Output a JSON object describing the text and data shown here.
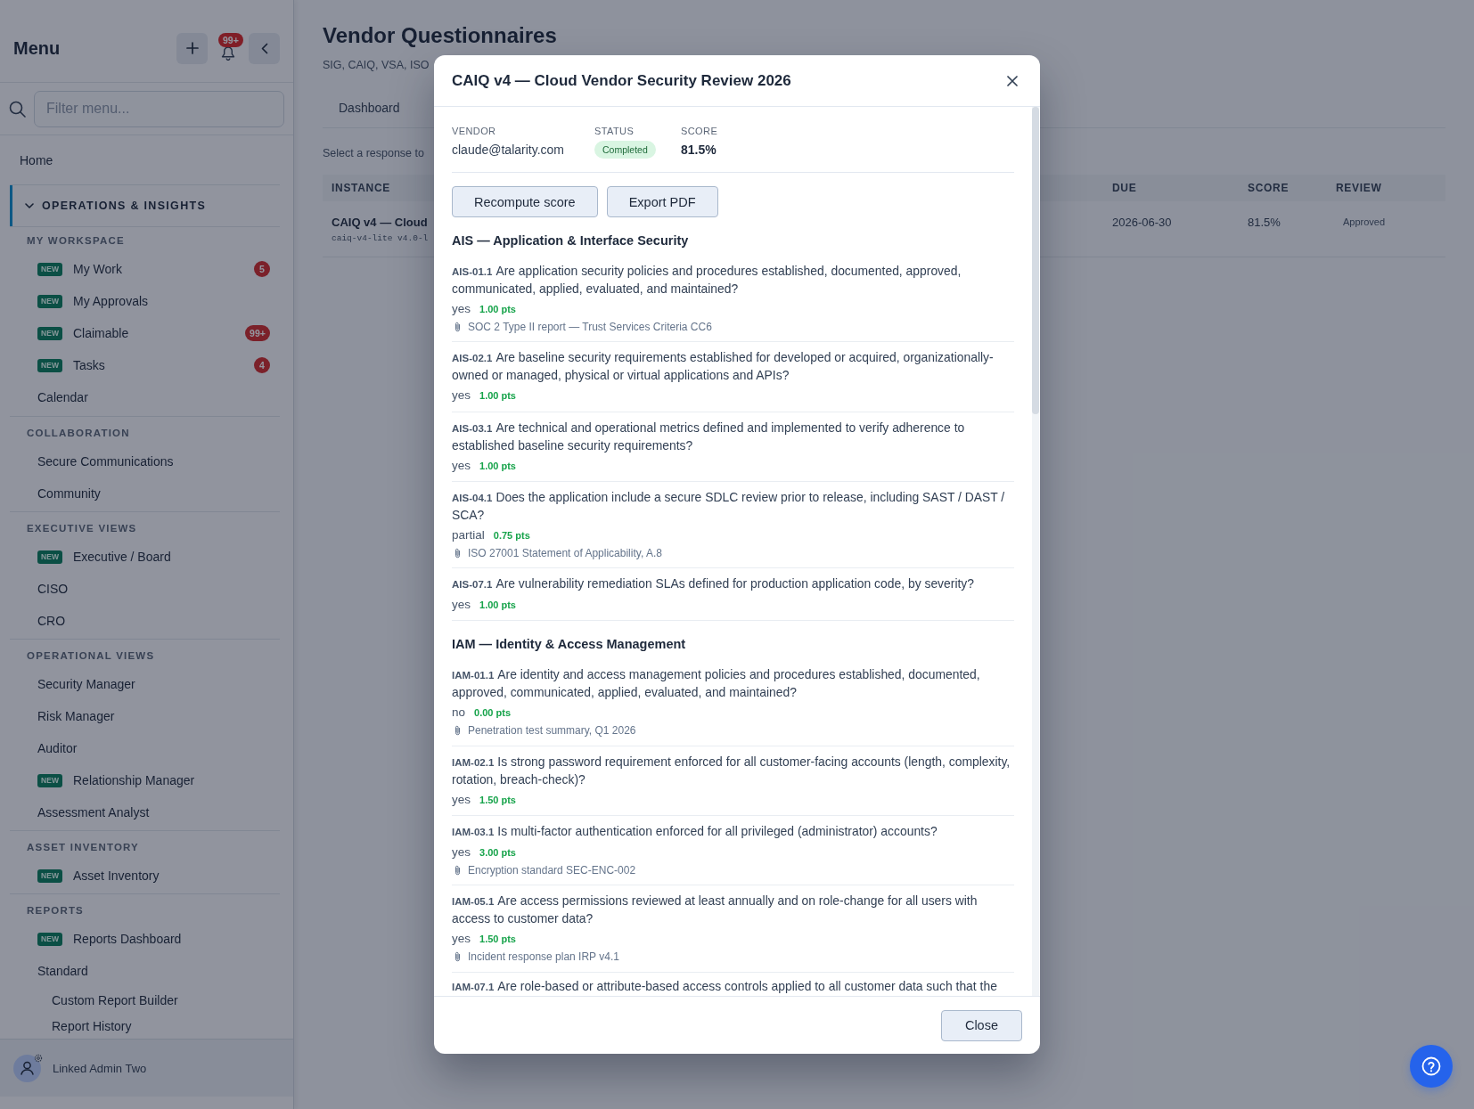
{
  "sidebar": {
    "title": "Menu",
    "notifications": "99+",
    "filter": {
      "placeholder": "Filter menu..."
    },
    "home": "Home",
    "section": {
      "label": "OPERATIONS & INSIGHTS",
      "expanded": true
    },
    "groups": [
      {
        "heading": "MY WORKSPACE",
        "items": [
          {
            "label": "My Work",
            "tag": "NEW",
            "count": "5"
          },
          {
            "label": "My Approvals",
            "tag": "NEW"
          },
          {
            "label": "Claimable",
            "tag": "NEW",
            "count": "99+"
          },
          {
            "label": "Tasks",
            "tag": "NEW",
            "count": "4"
          },
          {
            "label": "Calendar"
          }
        ]
      },
      {
        "heading": "COLLABORATION",
        "items": [
          {
            "label": "Secure Communications"
          },
          {
            "label": "Community"
          }
        ]
      },
      {
        "heading": "EXECUTIVE VIEWS",
        "items": [
          {
            "label": "Executive / Board",
            "tag": "NEW"
          },
          {
            "label": "CISO"
          },
          {
            "label": "CRO"
          }
        ]
      },
      {
        "heading": "OPERATIONAL VIEWS",
        "items": [
          {
            "label": "Security Manager"
          },
          {
            "label": "Risk Manager"
          },
          {
            "label": "Auditor"
          },
          {
            "label": "Relationship Manager",
            "tag": "NEW"
          },
          {
            "label": "Assessment Analyst"
          }
        ]
      },
      {
        "heading": "ASSET INVENTORY",
        "items": [
          {
            "label": "Asset Inventory",
            "tag": "NEW"
          }
        ]
      },
      {
        "heading": "REPORTS",
        "items": [
          {
            "label": "Reports Dashboard",
            "tag": "NEW"
          },
          {
            "label": "Standard",
            "children": [
              {
                "label": "Custom Report Builder"
              },
              {
                "label": "Report History"
              }
            ]
          }
        ]
      }
    ],
    "user": {
      "name": "Linked Admin Two"
    }
  },
  "page": {
    "title": "Vendor Questionnaires",
    "subtitle": "SIG, CAIQ, VSA, ISO",
    "tabs": [
      {
        "label": "Dashboard",
        "selected": false
      }
    ],
    "hint": "Select a response to",
    "table": {
      "columns": [
        "INSTANCE",
        "DUE",
        "SCORE",
        "REVIEW"
      ],
      "rows": [
        {
          "instance": {
            "name": "CAIQ v4 — Cloud",
            "code": "caiq-v4-lite v4.0-l"
          },
          "due": "2026-06-30",
          "score": "81.5%",
          "review": "Approved"
        }
      ]
    }
  },
  "modal": {
    "title": "CAIQ v4 — Cloud Vendor Security Review 2026",
    "meta": [
      {
        "label": "VENDOR",
        "value": "claude@talarity.com",
        "kind": "text"
      },
      {
        "label": "STATUS",
        "value": "Completed",
        "kind": "badge"
      },
      {
        "label": "SCORE",
        "value": "81.5%",
        "kind": "strong"
      }
    ],
    "actions": [
      "Recompute score",
      "Export PDF"
    ],
    "sections": [
      {
        "heading": "AIS — Application & Interface Security",
        "questions": [
          {
            "id": "AIS-01.1",
            "text": "Are application security policies and procedures established, documented, approved, communicated, applied, evaluated, and maintained?",
            "answer": "yes",
            "points": "1.00 pts",
            "attachment": "SOC 2 Type II report — Trust Services Criteria CC6"
          },
          {
            "id": "AIS-02.1",
            "text": "Are baseline security requirements established for developed or acquired, organizationally-owned or managed, physical or virtual applications and APIs?",
            "answer": "yes",
            "points": "1.00 pts"
          },
          {
            "id": "AIS-03.1",
            "text": "Are technical and operational metrics defined and implemented to verify adherence to established baseline security requirements?",
            "answer": "yes",
            "points": "1.00 pts"
          },
          {
            "id": "AIS-04.1",
            "text": "Does the application include a secure SDLC review prior to release, including SAST / DAST / SCA?",
            "answer": "partial",
            "points": "0.75 pts",
            "attachment": "ISO 27001 Statement of Applicability, A.8"
          },
          {
            "id": "AIS-07.1",
            "text": "Are vulnerability remediation SLAs defined for production application code, by severity?",
            "answer": "yes",
            "points": "1.00 pts"
          }
        ]
      },
      {
        "heading": "IAM — Identity & Access Management",
        "questions": [
          {
            "id": "IAM-01.1",
            "text": "Are identity and access management policies and procedures established, documented, approved, communicated, applied, evaluated, and maintained?",
            "answer": "no",
            "points": "0.00 pts",
            "attachment": "Penetration test summary, Q1 2026"
          },
          {
            "id": "IAM-02.1",
            "text": "Is strong password requirement enforced for all customer-facing accounts (length, complexity, rotation, breach-check)?",
            "answer": "yes",
            "points": "1.50 pts"
          },
          {
            "id": "IAM-03.1",
            "text": "Is multi-factor authentication enforced for all privileged (administrator) accounts?",
            "answer": "yes",
            "points": "3.00 pts",
            "attachment": "Encryption standard SEC-ENC-002"
          },
          {
            "id": "IAM-05.1",
            "text": "Are access permissions reviewed at least annually and on role-change for all users with access to customer data?",
            "answer": "yes",
            "points": "1.50 pts",
            "attachment": "Incident response plan IRP v4.1"
          },
          {
            "id": "IAM-07.1",
            "text": "Are role-based or attribute-based access controls applied to all customer data such that the"
          }
        ]
      }
    ],
    "close": "Close"
  }
}
